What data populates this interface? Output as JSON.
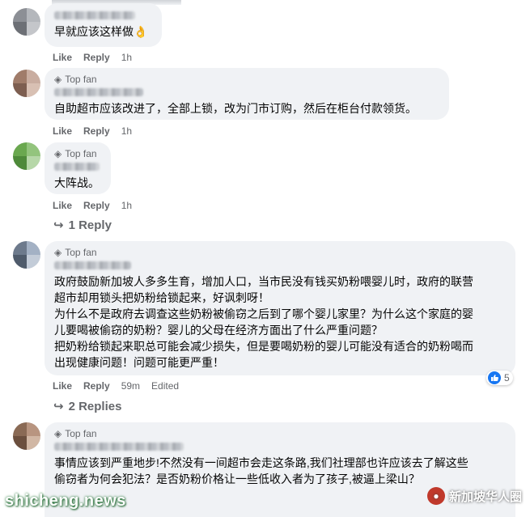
{
  "comments": [
    {
      "badge": "",
      "text": "早就应该这样做👌",
      "actions": {
        "like": "Like",
        "reply": "Reply",
        "time": "1h",
        "edited": ""
      },
      "avatar_colors": [
        "#8c8f95",
        "#b4b7bc",
        "#6d7076",
        "#c4c6ca"
      ]
    },
    {
      "badge": "Top fan",
      "text": "自助超市应该改进了，全部上锁，改为门市订购，然后在柜台付款领货。",
      "actions": {
        "like": "Like",
        "reply": "Reply",
        "time": "1h",
        "edited": ""
      },
      "avatar_colors": [
        "#a07c6a",
        "#c9ada0",
        "#7d5e50",
        "#d8c0b3"
      ]
    },
    {
      "badge": "Top fan",
      "text": "大阵战。",
      "actions": {
        "like": "Like",
        "reply": "Reply",
        "time": "1h",
        "edited": ""
      },
      "replies": "1 Reply",
      "avatar_colors": [
        "#6aa84f",
        "#93c47d",
        "#4e8a3a",
        "#b6d7a8"
      ]
    },
    {
      "badge": "Top fan",
      "text": "政府鼓励新加坡人多多生育，增加人口，当市民没有钱买奶粉喂婴儿时，政府的联营\n超市却用锁头把奶粉给锁起来，好讽刺呀！\n为什么不是政府去调查这些奶粉被偷窃之后到了哪个婴儿家里？为什么这个家庭的婴\n儿要喝被偷窃的奶粉？婴儿的父母在经济方面出了什么严重问题？\n把奶粉给锁起来职总可能会减少损失，但是要喝奶粉的婴儿可能没有适合的奶粉喝而\n出现健康问题！问题可能更严重！",
      "actions": {
        "like": "Like",
        "reply": "Reply",
        "time": "59m",
        "edited": "Edited"
      },
      "reaction_count": "5",
      "replies": "2 Replies",
      "avatar_colors": [
        "#6d7a8c",
        "#a3b1c4",
        "#4f5b6b",
        "#c3ccd8"
      ]
    },
    {
      "badge": "Top fan",
      "text": "事情应该到严重地步!不然没有一间超市会走这条路,我们社理部也许应该去了解这些\n偷窃者为何会犯法？是否奶粉价格让一些低收入者为了孩子,被逼上梁山？",
      "actions": {
        "like": "",
        "reply": "",
        "time": "",
        "edited": ""
      },
      "avatar_colors": [
        "#8a6a55",
        "#b89580",
        "#6b4f3e",
        "#d1b7a4"
      ]
    }
  ],
  "watermark": {
    "left": "shicheng.news",
    "right": "新加坡华人圈"
  }
}
